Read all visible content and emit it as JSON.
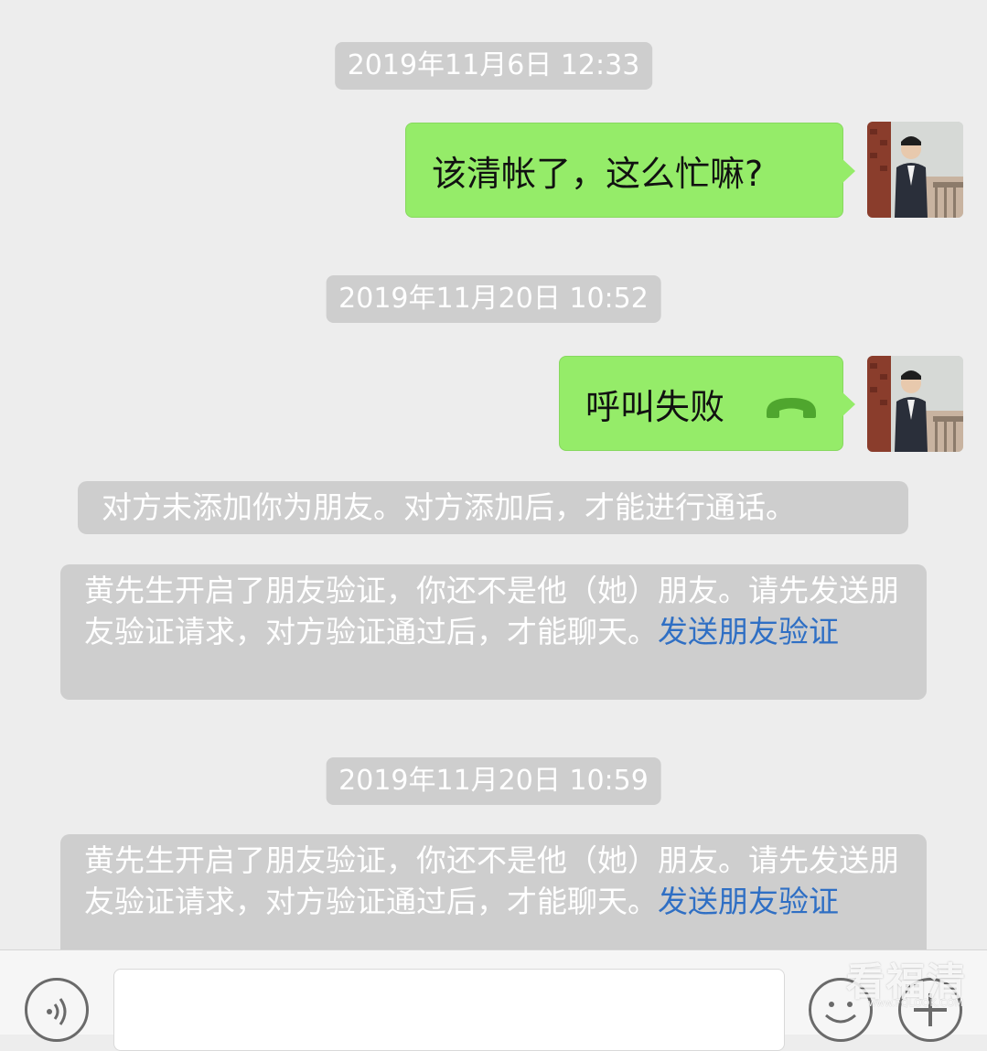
{
  "messages": {
    "ts1": "2019年11月6日 12:33",
    "msg1": "该清帐了，这么忙嘛?",
    "ts2": "2019年11月20日 10:52",
    "call_text": "呼叫失败",
    "sys_not_friend": "对方未添加你为朋友。对方添加后，才能进行通话。",
    "sys_verify_1": {
      "text": "黄先生开启了朋友验证，你还不是他（她）朋友。请先发送朋友验证请求，对方验证通过后，才能聊天。",
      "link": "发送朋友验证"
    },
    "ts3": "2019年11月20日 10:59",
    "sys_verify_2": {
      "text": "黄先生开启了朋友验证，你还不是他（她）朋友。请先发送朋友验证请求，对方验证通过后，才能聊天。",
      "link": "发送朋友验证"
    }
  },
  "bottom": {
    "input_value": "",
    "icons": [
      "voice-icon",
      "emoji-icon",
      "plus-icon"
    ]
  },
  "watermark": {
    "text": "看福清",
    "sub": "www.FQLOOK.COM"
  },
  "colors": {
    "background": "#ededed",
    "bubble_green": "#95ec69",
    "system_gray": "#cecece",
    "link_blue": "#2f6fc4",
    "call_icon": "#4fa62e"
  }
}
